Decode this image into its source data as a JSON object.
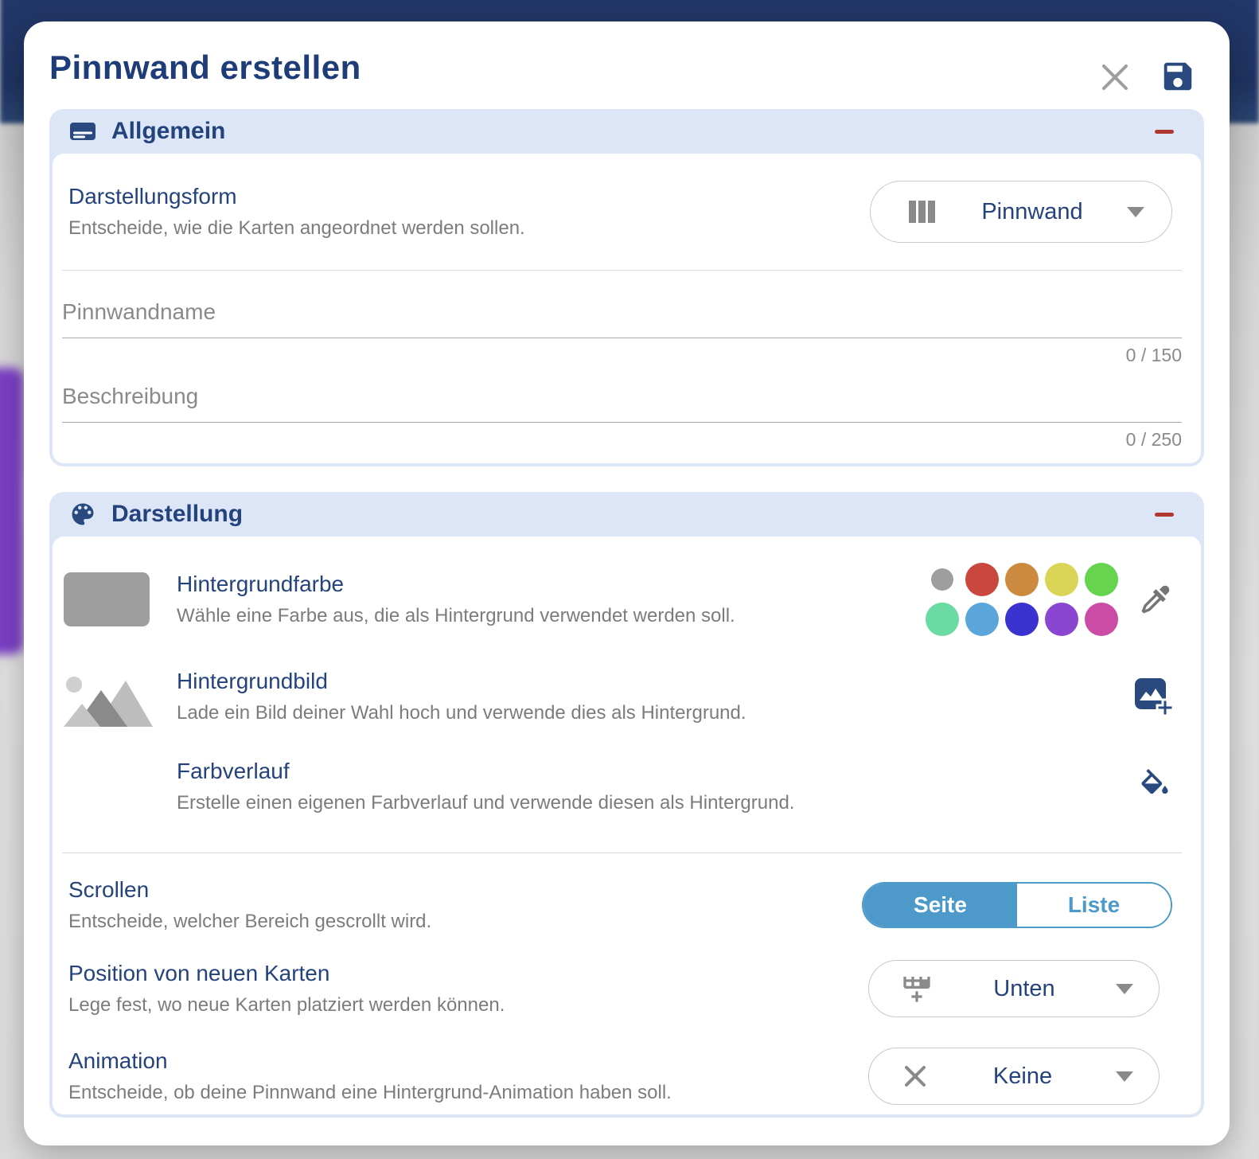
{
  "modal": {
    "title": "Pinnwand erstellen"
  },
  "colors": {
    "navy_text": "#24437c",
    "icon_navy": "#2a4a7f",
    "section_bg": "#dce6f6",
    "desc_gray": "#7c7c7c",
    "minus_red": "#b13831",
    "toggle_blue": "#4d9aca",
    "thumb_gray": "#9e9e9e"
  },
  "sections": {
    "allgemein": {
      "title": "Allgemein",
      "rows": {
        "darstellungsform": {
          "label": "Darstellungsform",
          "description": "Entscheide, wie die Karten angeordnet werden sollen.",
          "dropdown": {
            "value": "Pinnwand"
          }
        },
        "pinnwandname": {
          "label": "Pinnwandname",
          "counter": "0 / 150"
        },
        "beschreibung": {
          "label": "Beschreibung",
          "counter": "0 / 250"
        }
      }
    },
    "darstellung": {
      "title": "Darstellung",
      "rows": {
        "hintergrundfarbe": {
          "label": "Hintergrundfarbe",
          "description": "Wähle eine Farbe aus, die als Hintergrund verwendet werden soll.",
          "swatches": [
            "#9e9e9e",
            "#c9473c",
            "#cc8a41",
            "#d9d455",
            "#66d44e",
            "#69dba3",
            "#5aa5da",
            "#3b33cf",
            "#8a46d1",
            "#cc4ba5"
          ]
        },
        "hintergrundbild": {
          "label": "Hintergrundbild",
          "description": "Lade ein Bild deiner Wahl hoch und verwende dies als Hintergrund."
        },
        "farbverlauf": {
          "label": "Farbverlauf",
          "description": "Erstelle einen eigenen Farbverlauf und verwende diesen als Hintergrund."
        },
        "scrollen": {
          "label": "Scrollen",
          "description": "Entscheide, welcher Bereich gescrollt wird.",
          "toggle": {
            "selected": "Seite",
            "options": [
              "Seite",
              "Liste"
            ]
          }
        },
        "position": {
          "label": "Position von neuen Karten",
          "description": "Lege fest, wo neue Karten platziert werden können.",
          "dropdown": {
            "value": "Unten"
          }
        },
        "animation": {
          "label": "Animation",
          "description": "Entscheide, ob deine Pinnwand eine Hintergrund-Animation haben soll.",
          "dropdown": {
            "value": "Keine"
          }
        }
      }
    }
  }
}
